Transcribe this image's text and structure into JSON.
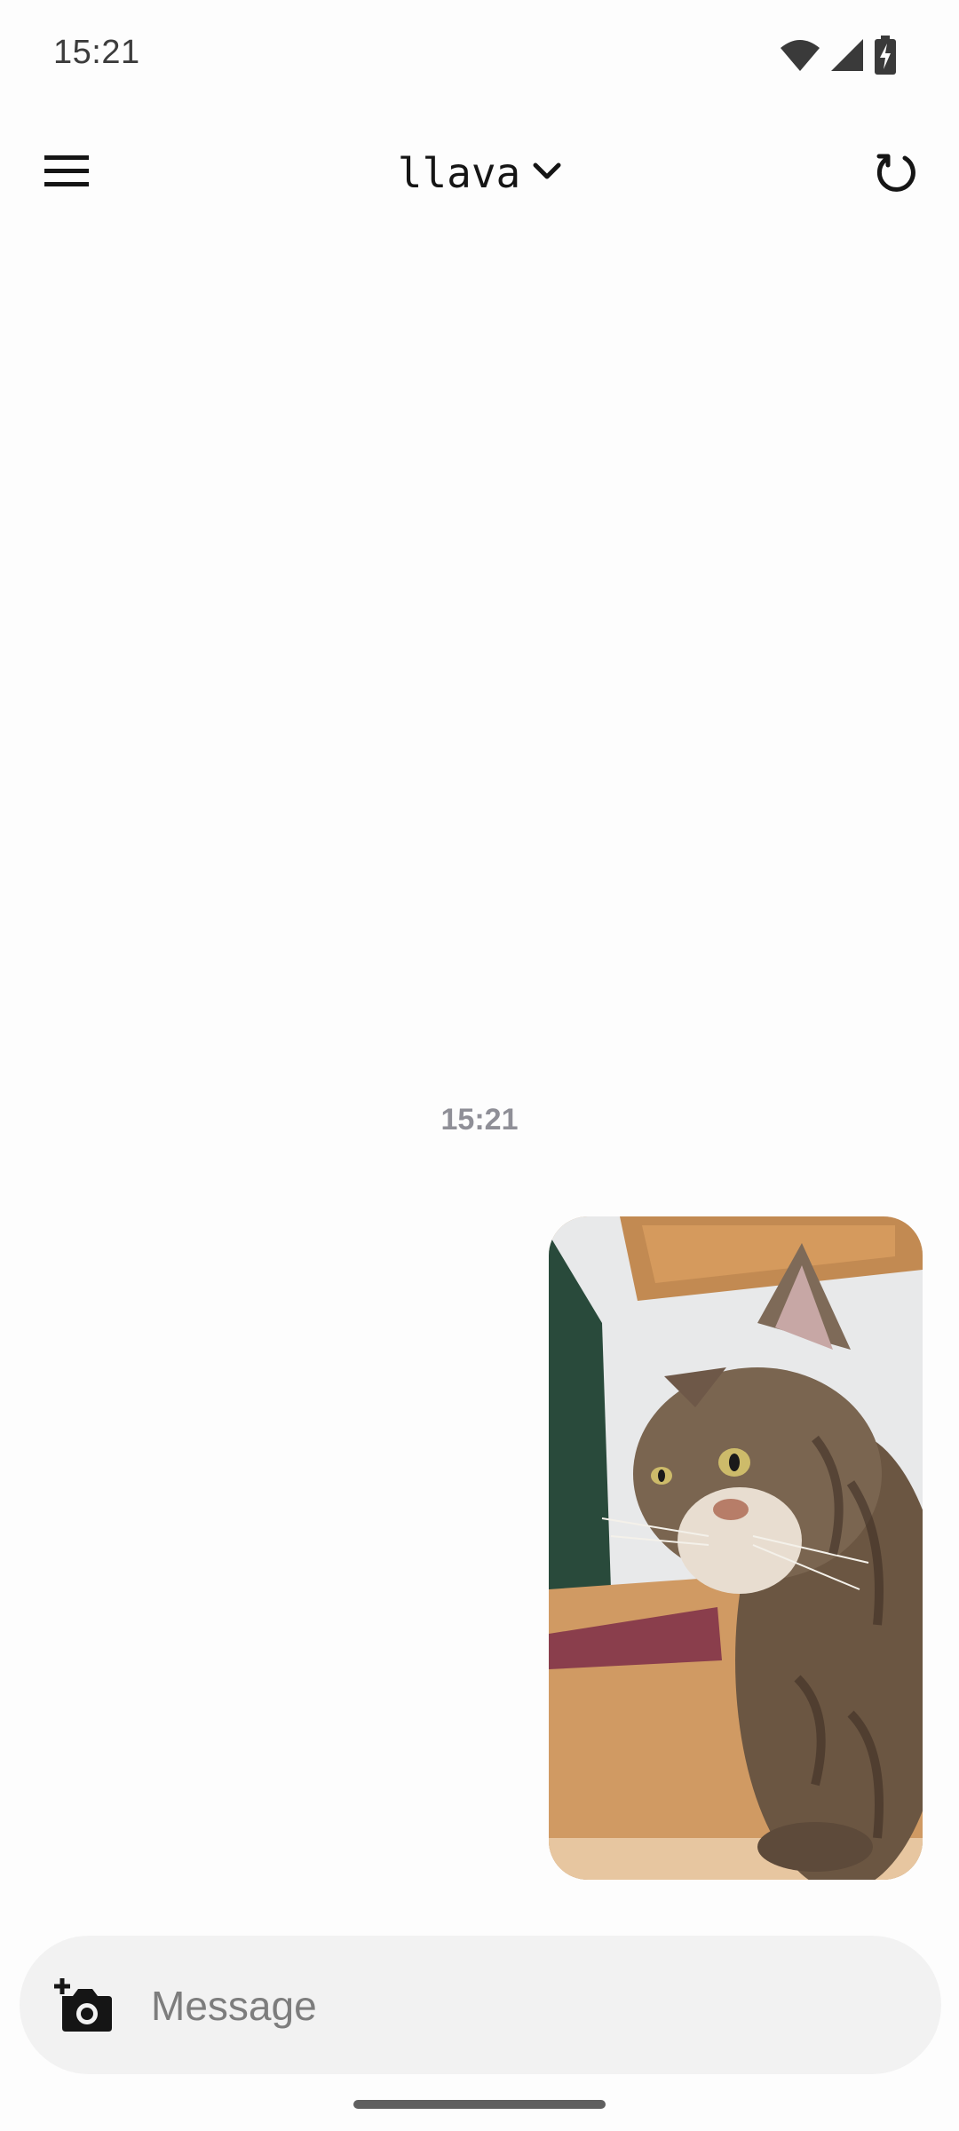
{
  "status_bar": {
    "time": "15:21",
    "icons": [
      "wifi-icon",
      "cellular-signal-icon",
      "battery-charging-icon"
    ]
  },
  "app_bar": {
    "menu_icon": "hamburger-menu-icon",
    "model_name": "llava",
    "dropdown_icon": "chevron-down-icon",
    "refresh_icon": "refresh-icon"
  },
  "chat": {
    "timestamp": "15:21",
    "messages": [
      {
        "sender": "user",
        "type": "image",
        "content": "photo of a tabby cat"
      }
    ]
  },
  "composer": {
    "camera_icon": "add-photo-camera-icon",
    "placeholder": "Message",
    "value": ""
  },
  "colors": {
    "background": "#fdfdfd",
    "composer_background": "#f2f2f2",
    "timestamp_text": "#8f8f97",
    "icon": "#151515"
  }
}
